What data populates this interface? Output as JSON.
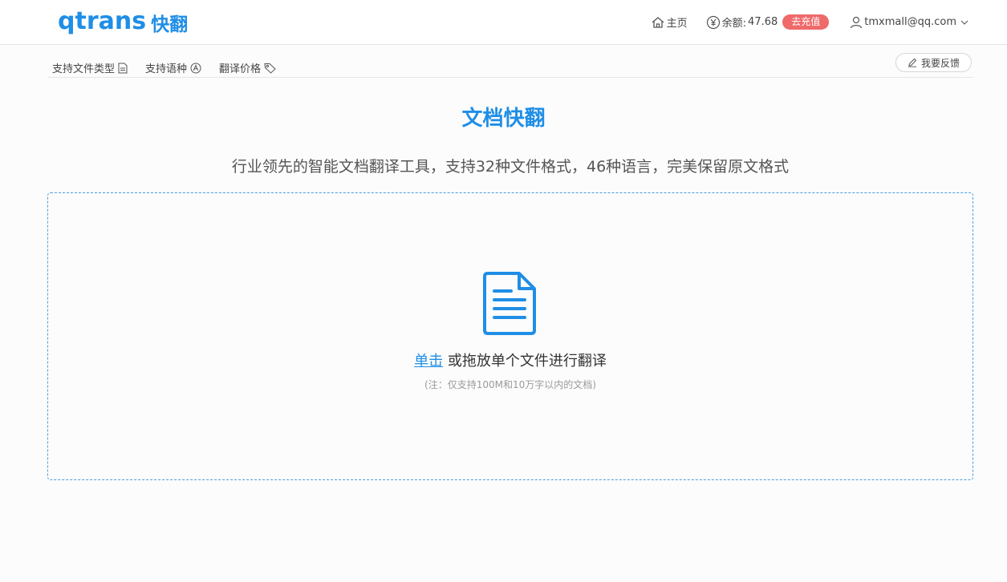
{
  "brand": {
    "logo_text": "qtrans",
    "logo_cn": "快翻",
    "color": "#1f8ee6"
  },
  "header": {
    "home_label": "主页",
    "balance_label": "余额:",
    "balance_value": "47.68",
    "recharge_label": "去充值",
    "user_email": "tmxmall@qq.com",
    "icons": [
      "home-icon",
      "yen-icon",
      "user-icon",
      "chevron-down-icon"
    ]
  },
  "subnav": {
    "items": [
      {
        "label": "支持文件类型",
        "icon": "file-icon"
      },
      {
        "label": "支持语种",
        "icon": "letter-a-icon"
      },
      {
        "label": "翻译价格",
        "icon": "tag-icon"
      }
    ],
    "feedback_label": "我要反馈",
    "feedback_icon": "edit-icon"
  },
  "main": {
    "title": "文档快翻",
    "subtitle": "行业领先的智能文档翻译工具，支持32种文件格式，46种语言，完美保留原文格式",
    "upload": {
      "click_label": "单击",
      "instruction": " 或拖放单个文件进行翻译",
      "note": "(注：仅支持100M和10万字以内的文档)",
      "icon": "document-icon"
    }
  },
  "colors": {
    "accent": "#1f8ee6",
    "recharge_bg": "#ef6a6a",
    "dropzone_border": "#4a9fe0"
  }
}
